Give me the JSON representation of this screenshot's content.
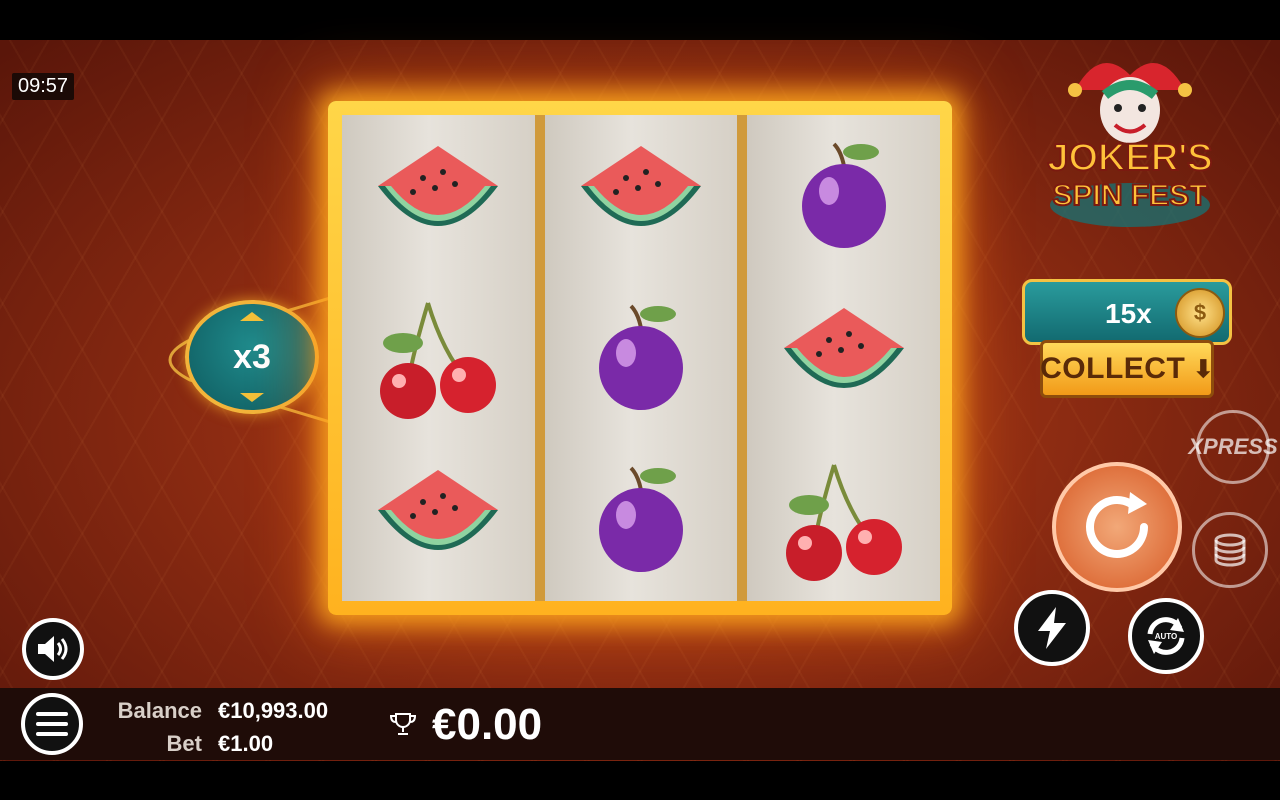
{
  "status": {
    "time": "09:57"
  },
  "game": {
    "logo_line1": "JOKER'S",
    "logo_line2": "SPIN FEST",
    "logo_icon": "joker-jester-icon"
  },
  "multiplier": {
    "label": "x3"
  },
  "collect": {
    "count": "15x",
    "button_label": "COLLECT",
    "coin_icon": "coin-stack-icon"
  },
  "reels": [
    {
      "symbols": [
        "watermelon",
        "cherries",
        "watermelon"
      ]
    },
    {
      "symbols": [
        "watermelon",
        "plum",
        "plum"
      ]
    },
    {
      "symbols": [
        "plum",
        "watermelon",
        "cherries"
      ]
    }
  ],
  "controls": {
    "xpress_label": "XPRESS",
    "auto_label": "AUTO",
    "icons": [
      "sound-icon",
      "menu-icon",
      "spin-icon",
      "turbo-icon",
      "autoplay-icon",
      "coin-stack-icon",
      "trophy-icon"
    ]
  },
  "footer": {
    "balance_label": "Balance",
    "balance_value": "€10,993.00",
    "bet_label": "Bet",
    "bet_value": "€1.00",
    "win_value": "€0.00"
  },
  "colors": {
    "accent_gold": "#f4c243",
    "teal": "#1f8b8c",
    "background_red": "#8e2c12",
    "spin_orange": "#d75a25"
  }
}
